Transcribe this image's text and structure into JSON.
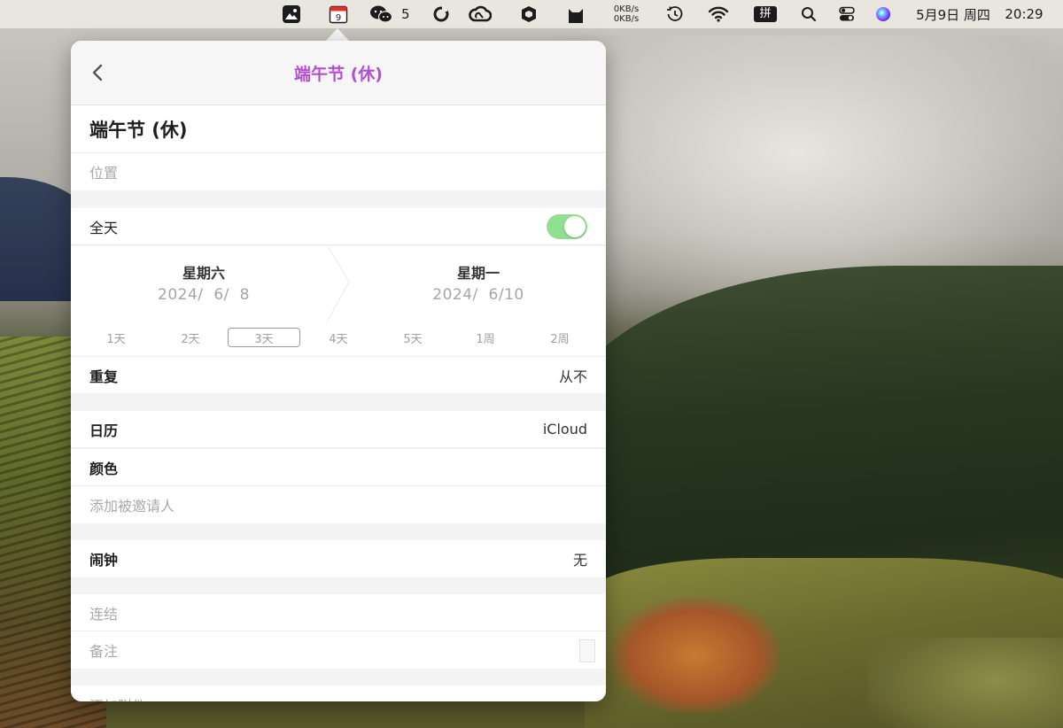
{
  "menubar": {
    "wechat_badge": "5",
    "calendar_day": "9",
    "net_up": "0KB/s",
    "net_down": "0KB/s",
    "ime_label": "拼",
    "date": "5月9日 周四",
    "time": "20:29",
    "icons": [
      "gallery-icon",
      "calendar-icon",
      "wechat-icon",
      "sync-icon",
      "creative-cloud-icon",
      "shield-icon",
      "cat-icon",
      "time-machine-icon",
      "wifi-icon",
      "ime-icon",
      "spotlight-icon",
      "control-center-icon",
      "siri-icon"
    ]
  },
  "popover": {
    "header_title": "端午节 (休)",
    "event_title": "端午节 (休)",
    "location_placeholder": "位置",
    "all_day": {
      "label": "全天",
      "on": true
    },
    "start": {
      "weekday": "星期六",
      "date": "2024/  6/  8"
    },
    "end": {
      "weekday": "星期一",
      "date": "2024/  6/10"
    },
    "durations": [
      {
        "label": "1天",
        "selected": false
      },
      {
        "label": "2天",
        "selected": false
      },
      {
        "label": "3天",
        "selected": true
      },
      {
        "label": "4天",
        "selected": false
      },
      {
        "label": "5天",
        "selected": false
      },
      {
        "label": "1周",
        "selected": false
      },
      {
        "label": "2周",
        "selected": false
      }
    ],
    "repeat": {
      "label": "重复",
      "value": "从不"
    },
    "calendar": {
      "label": "日历",
      "value": "iCloud"
    },
    "color": {
      "label": "颜色"
    },
    "invitees_placeholder": "添加被邀请人",
    "alarm": {
      "label": "闹钟",
      "value": "无"
    },
    "url_placeholder": "连结",
    "notes_placeholder": "备注",
    "attachment_placeholder": "添加附件"
  },
  "colors": {
    "accent_title": "#b44fd1",
    "toggle_on": "#91e08f"
  }
}
